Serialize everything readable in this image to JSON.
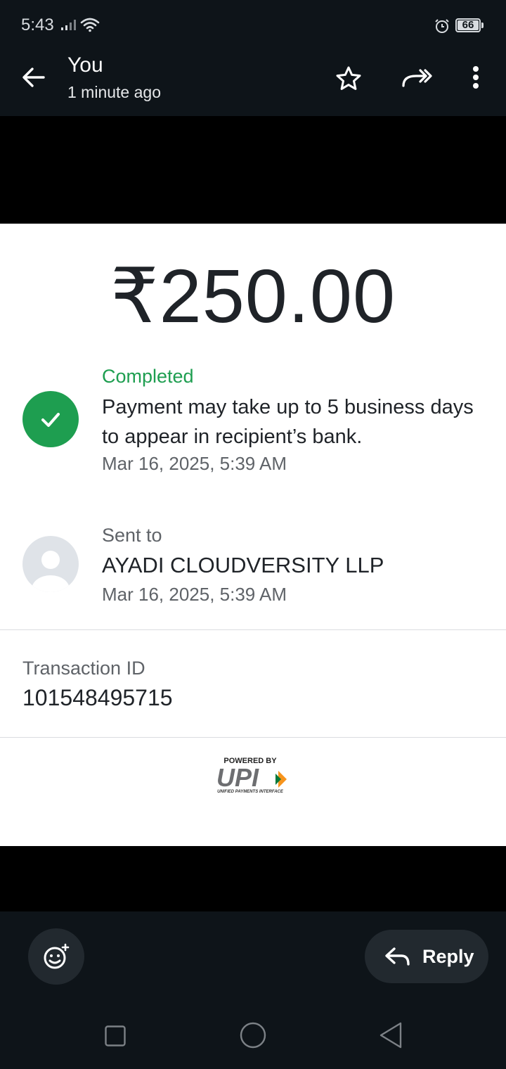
{
  "status_bar": {
    "time": "5:43",
    "battery": "66"
  },
  "header": {
    "title": "You",
    "subtitle": "1 minute ago",
    "icons": [
      "back-arrow-icon",
      "star-icon",
      "forward-icon",
      "more-vert-icon"
    ]
  },
  "payment": {
    "amount": "₹250.00",
    "status_label": "Completed",
    "status_note": "Payment may take up to 5 business days to appear in recipient’s bank.",
    "status_date": "Mar 16, 2025, 5:39 AM",
    "status_color": "#1e9e50"
  },
  "recipient": {
    "label": "Sent to",
    "name": "AYADI CLOUDVERSITY LLP",
    "date": "Mar 16, 2025, 5:39 AM"
  },
  "transaction": {
    "label": "Transaction ID",
    "id": "101548495715"
  },
  "upi": {
    "powered_by": "POWERED BY",
    "logo_text": "UPI",
    "tagline": "UNIFIED PAYMENTS INTERFACE"
  },
  "actions": {
    "reply_label": "Reply"
  }
}
